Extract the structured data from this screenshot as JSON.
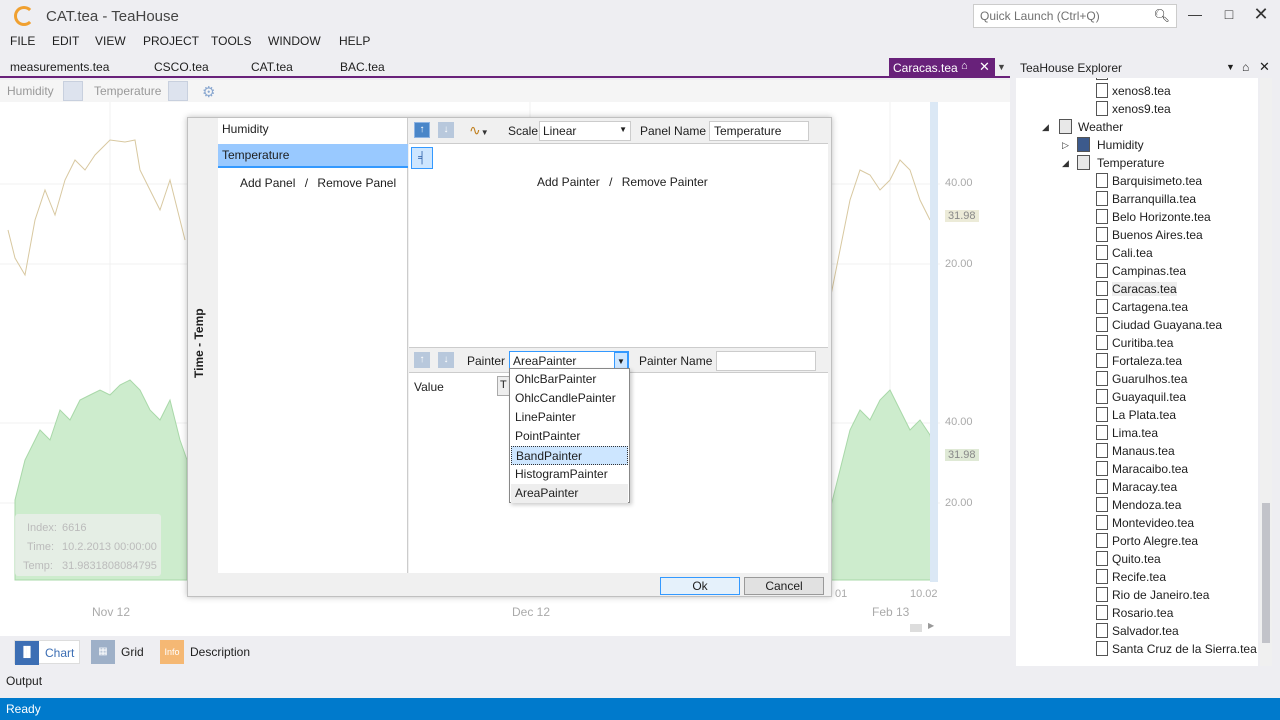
{
  "app": {
    "title": "CAT.tea - TeaHouse",
    "quick_launch_placeholder": "Quick Launch (Ctrl+Q)"
  },
  "menu": [
    "FILE",
    "EDIT",
    "VIEW",
    "PROJECT",
    "TOOLS",
    "WINDOW",
    "HELP"
  ],
  "doc_tabs": [
    "measurements.tea",
    "CSCO.tea",
    "CAT.tea",
    "BAC.tea"
  ],
  "active_doc_tab": "Caracas.tea",
  "panel_toolbar": {
    "humidity_label": "Humidity",
    "temperature_label": "Temperature"
  },
  "chart_bg": {
    "y_ticks_top": [
      "40.00",
      "20.00"
    ],
    "current_top": "31.98",
    "y_ticks_bottom": [
      "40.00",
      "20.00"
    ],
    "current_bottom": "31.98",
    "x_labels": [
      "Nov 12",
      "Dec 12",
      "Feb 13"
    ],
    "x_partial": [
      "01",
      "10.02"
    ],
    "info": {
      "index_label": "Index:",
      "index_value": "6616",
      "time_label": "Time:",
      "time_value": "10.2.2013 00:00:00",
      "temp_label": "Temp:",
      "temp_value": "31.9831808084795"
    }
  },
  "dialog": {
    "side_label": "Time - Temp",
    "panels": [
      "Humidity",
      "Temperature"
    ],
    "add_panel": "Add Panel",
    "remove_panel": "Remove Panel",
    "slash": "/",
    "scale_label": "Scale",
    "scale_value": "Linear",
    "panel_name_label": "Panel Name",
    "panel_name_value": "Temperature",
    "add_painter": "Add Painter",
    "remove_painter": "Remove Painter",
    "painter_label": "Painter",
    "painter_value": "AreaPainter",
    "painter_name_label": "Painter Name",
    "painter_name_value": "",
    "value_label": "Value",
    "value_btn": "T",
    "ok": "Ok",
    "cancel": "Cancel"
  },
  "painter_options": [
    "OhlcBarPainter",
    "OhlcCandlePainter",
    "LinePainter",
    "PointPainter",
    "BandPainter",
    "HistogramPainter",
    "AreaPainter"
  ],
  "bottom_tabs": {
    "chart": "Chart",
    "grid": "Grid",
    "info_icon": "Info",
    "description": "Description"
  },
  "output_label": "Output",
  "status": "Ready",
  "explorer": {
    "title": "TeaHouse Explorer",
    "top_files": [
      "xenos8.tea",
      "xenos9.tea"
    ],
    "weather": "Weather",
    "humidity": "Humidity",
    "temperature": "Temperature",
    "files": [
      "Barquisimeto.tea",
      "Barranquilla.tea",
      "Belo Horizonte.tea",
      "Buenos Aires.tea",
      "Cali.tea",
      "Campinas.tea",
      "Caracas.tea",
      "Cartagena.tea",
      "Ciudad Guayana.tea",
      "Curitiba.tea",
      "Fortaleza.tea",
      "Guarulhos.tea",
      "Guayaquil.tea",
      "La Plata.tea",
      "Lima.tea",
      "Manaus.tea",
      "Maracaibo.tea",
      "Maracay.tea",
      "Mendoza.tea",
      "Montevideo.tea",
      "Porto Alegre.tea",
      "Quito.tea",
      "Recife.tea",
      "Rio de Janeiro.tea",
      "Rosario.tea",
      "Salvador.tea",
      "Santa Cruz de la Sierra.tea"
    ]
  }
}
